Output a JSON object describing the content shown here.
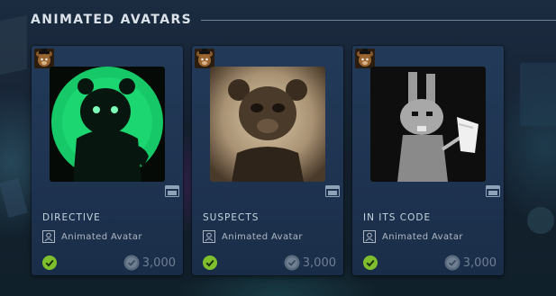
{
  "section": {
    "title": "ANIMATED AVATARS"
  },
  "items": [
    {
      "name": "DIRECTIVE",
      "type_label": "Animated Avatar",
      "price": "3,000"
    },
    {
      "name": "SUSPECTS",
      "type_label": "Animated Avatar",
      "price": "3,000"
    },
    {
      "name": "IN ITS CODE",
      "type_label": "Animated Avatar",
      "price": "3,000"
    }
  ],
  "colors": {
    "owned_green": "#7fbf2e",
    "card_bg": "#223a58",
    "directive_glow": "#2edc7a"
  },
  "icons": {
    "badge": "freddy-bear-badge-icon",
    "video": "video-clip-icon",
    "type": "avatar-frame-icon",
    "owned": "owned-checkmark-icon",
    "points": "points-coin-icon"
  }
}
